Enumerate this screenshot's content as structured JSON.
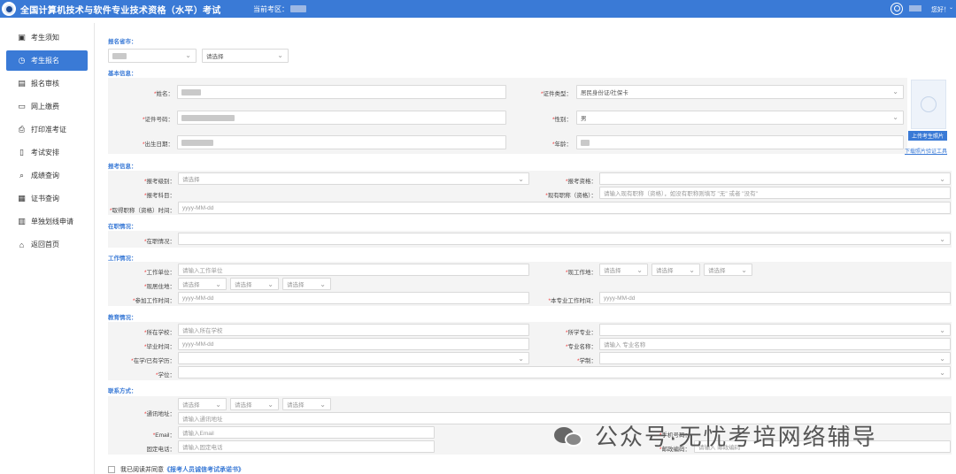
{
  "header": {
    "title": "全国计算机技术与软件专业技术资格（水平）考试",
    "region_label": "当前考区：",
    "greeting": "您好！",
    "caret": "⌄"
  },
  "sidebar": {
    "items": [
      {
        "label": "考生须知",
        "icon": "notice-icon",
        "glyph": "▣"
      },
      {
        "label": "考生报名",
        "icon": "clock-icon",
        "glyph": "◷"
      },
      {
        "label": "报名审核",
        "icon": "review-icon",
        "glyph": "▤"
      },
      {
        "label": "网上缴费",
        "icon": "monitor-icon",
        "glyph": "▭"
      },
      {
        "label": "打印准考证",
        "icon": "printer-icon",
        "glyph": "⎙"
      },
      {
        "label": "考试安排",
        "icon": "document-icon",
        "glyph": "▯"
      },
      {
        "label": "成绩查询",
        "icon": "search-icon",
        "glyph": "⌕"
      },
      {
        "label": "证书查询",
        "icon": "certificate-icon",
        "glyph": "▦"
      },
      {
        "label": "单独划线申请",
        "icon": "apply-icon",
        "glyph": "▥"
      },
      {
        "label": "返回首页",
        "icon": "home-icon",
        "glyph": "⌂"
      }
    ],
    "active_index": 1
  },
  "form": {
    "sections": {
      "province": "报名省市：",
      "basic": "基本信息：",
      "exam": "报考信息：",
      "job": "在职情况：",
      "work": "工作情况：",
      "edu": "教育情况：",
      "contact": "联系方式："
    },
    "province_select2": "请选择",
    "labels": {
      "name": "姓名：",
      "id_type": "证件类型：",
      "id_no": "证件号码：",
      "gender": "性别：",
      "birth": "出生日期：",
      "age": "年龄：",
      "level": "报考级别：",
      "qualification": "报考资格：",
      "subject": "报考科目：",
      "current_title": "现有职称（资格）：",
      "title_date": "取得职称（资格）时间：",
      "job_status": "在职情况：",
      "employer": "工作单位：",
      "work_place": "现工作地：",
      "residence": "现居住地：",
      "work_start": "参加工作时间：",
      "major_work_start": "本专业工作时间：",
      "school": "所在学校：",
      "school_major": "所学专业：",
      "grad_date": "毕业时间：",
      "major_name": "专业名称：",
      "education": "在学/已有学历：",
      "duration": "学制：",
      "degree": "学位：",
      "address": "通讯地址：",
      "email": "Email：",
      "phone": "固定电话：",
      "postcode": "邮政编码：",
      "mobile": "手机号码："
    },
    "values": {
      "id_type": "居民身份证/社保卡",
      "gender": "男"
    },
    "placeholders": {
      "select": "请选择",
      "current_title": "请输入现有职称（资格），如没有职称则填写 \"无\" 或者 \"没有\"",
      "date": "yyyy-MM-dd",
      "employer": "请输入工作单位",
      "school": "请输入所在学校",
      "major_name": "请输入 专业名称",
      "address": "请输入通讯地址",
      "email": "请输入Email",
      "phone": "请输入固定电话",
      "postcode": "请输入 邮政编码"
    },
    "upload_label": "上传考生照片",
    "tool_link": "下载照片验证工具",
    "agree_prefix": "我已阅读并同意",
    "agree_link": "《报考人员诚信考试承诺书》"
  },
  "watermark": {
    "text": "公众号·无忧考培网络辅导"
  },
  "colors": {
    "primary": "#3a7ad6",
    "panel": "#f4f4f4",
    "required": "#e33333"
  }
}
